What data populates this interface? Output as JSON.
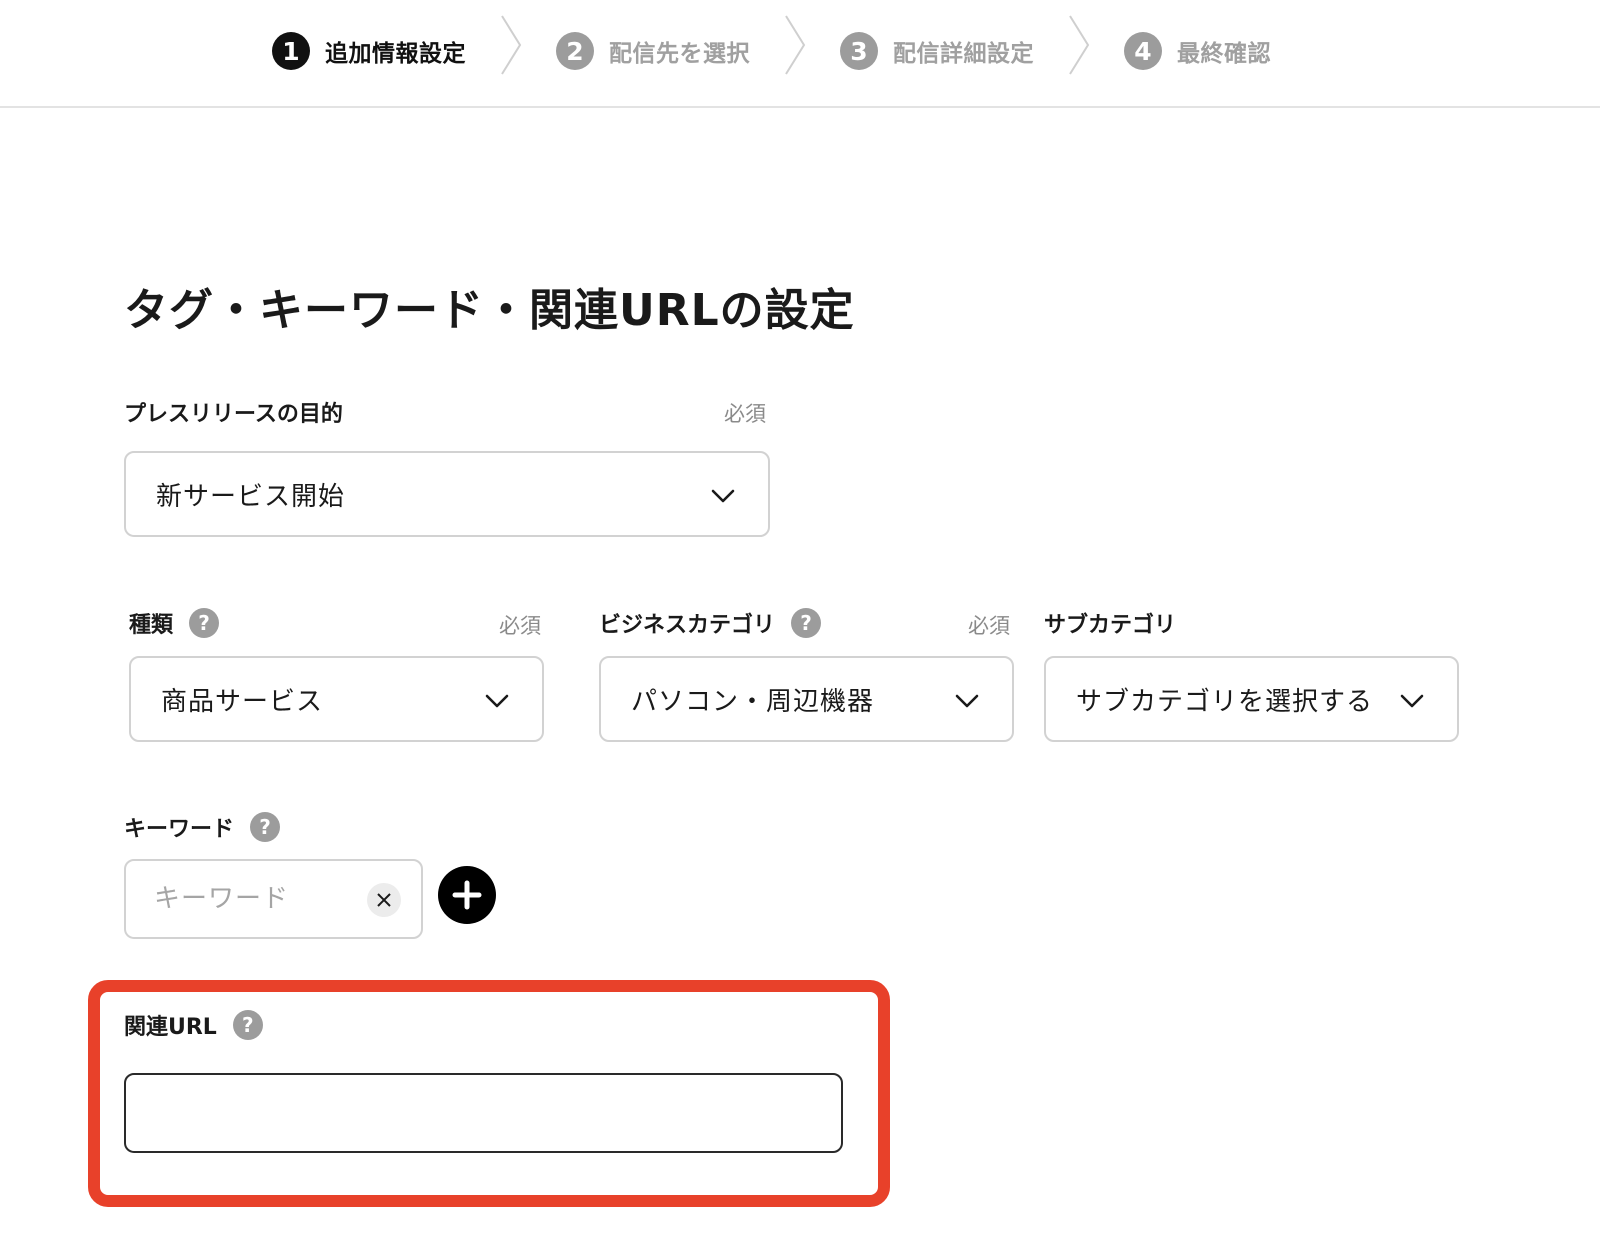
{
  "stepper": {
    "steps": [
      {
        "number": "1",
        "label": "追加情報設定",
        "state": "active"
      },
      {
        "number": "2",
        "label": "配信先を選択",
        "state": "inactive"
      },
      {
        "number": "3",
        "label": "配信詳細設定",
        "state": "inactive"
      },
      {
        "number": "4",
        "label": "最終確認",
        "state": "inactive"
      }
    ]
  },
  "page": {
    "title": "タグ・キーワード・関連URLの設定"
  },
  "purpose": {
    "label": "プレスリリースの目的",
    "required": "必須",
    "value": "新サービス開始"
  },
  "type": {
    "label": "種類",
    "required": "必須",
    "value": "商品サービス"
  },
  "business_category": {
    "label": "ビジネスカテゴリ",
    "required": "必須",
    "value": "パソコン・周辺機器"
  },
  "sub_category": {
    "label": "サブカテゴリ",
    "value": "サブカテゴリを選択する"
  },
  "keyword": {
    "label": "キーワード",
    "placeholder": "キーワード",
    "value": ""
  },
  "related_url": {
    "label": "関連URL",
    "value": ""
  },
  "help_glyph": "?",
  "colors": {
    "highlight": "#e8412a",
    "active_step": "#111111",
    "inactive_step": "#9c9c9c"
  }
}
